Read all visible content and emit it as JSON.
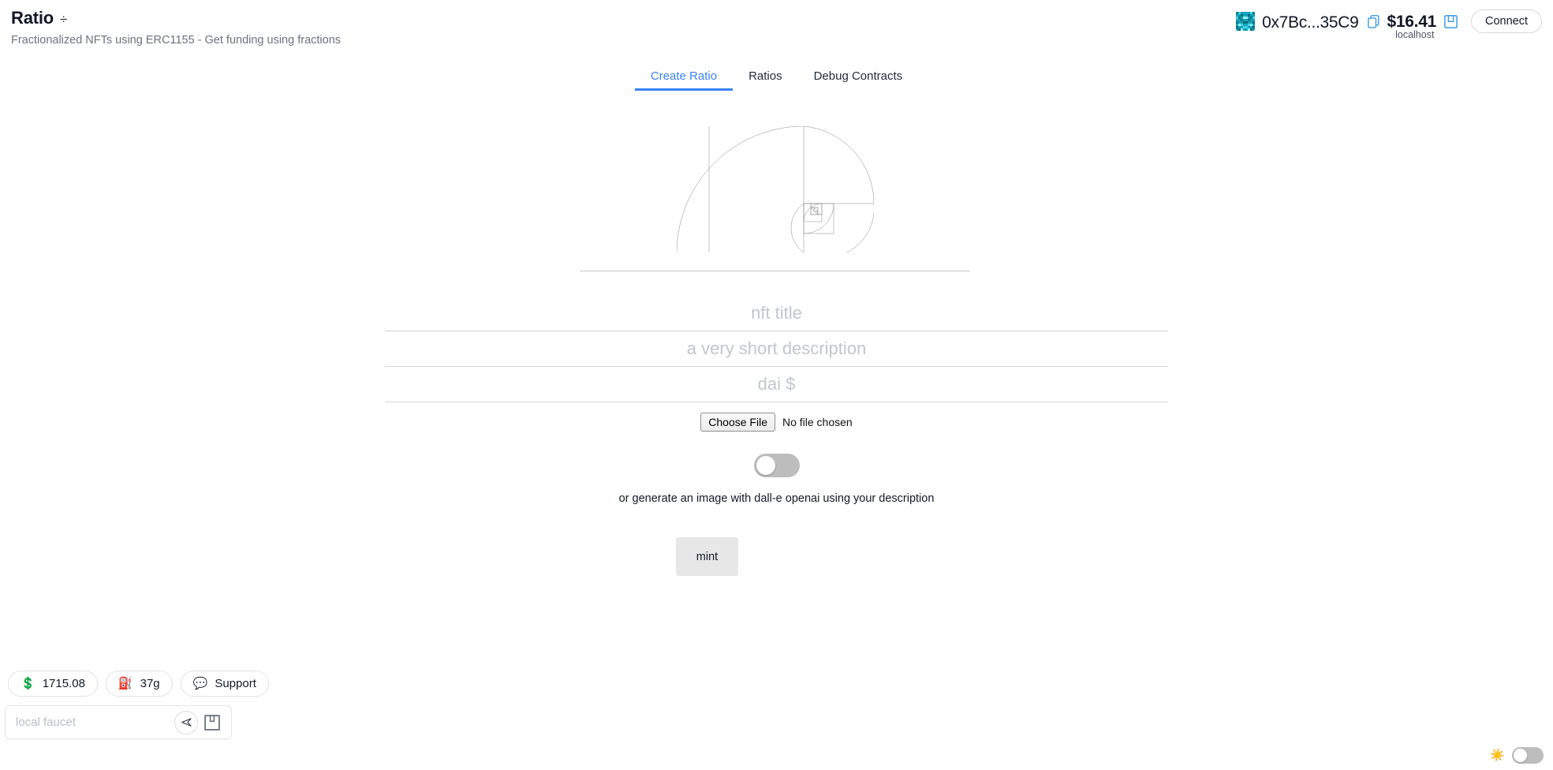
{
  "header": {
    "brand_title": "Ratio",
    "brand_icon": "divide-icon",
    "brand_icon_glyph": "÷",
    "brand_subtitle": "Fractionalized NFTs using ERC1155 - Get funding using fractions",
    "account": {
      "avatar": "blockie-avatar",
      "address": "0x7Bc...35C9",
      "copy_icon": "copy-icon",
      "balance": "$16.41",
      "network": "localhost",
      "save_icon": "save-icon",
      "connect_label": "Connect"
    }
  },
  "tabs": [
    {
      "label": "Create Ratio",
      "active": true
    },
    {
      "label": "Ratios",
      "active": false
    },
    {
      "label": "Debug Contracts",
      "active": false
    }
  ],
  "hero": {
    "graphic": "fibonacci-golden-spiral",
    "stroke_color": "#8a8a8a",
    "divider_color": "#c9c9c9"
  },
  "form": {
    "title_placeholder": "nft title",
    "title_value": "",
    "description_placeholder": "a very short description",
    "description_value": "",
    "price_placeholder": "dai $",
    "price_value": "",
    "choose_file_label": "Choose File",
    "no_file_label": "No file chosen",
    "dalle_toggle_state": "off",
    "dalle_caption": "or generate an image with dall-e openai using your description",
    "mint_label": "mint"
  },
  "bottom_left": {
    "pills": [
      {
        "icon": "dollar-icon",
        "glyph": "💲",
        "label": "1715.08"
      },
      {
        "icon": "gas-pump-icon",
        "glyph": "⛽",
        "label": "37g"
      },
      {
        "icon": "speech-bubble-icon",
        "glyph": "💬",
        "label": "Support"
      }
    ],
    "faucet_placeholder": "local faucet",
    "faucet_value": "",
    "send_icon": "send-icon",
    "bank_icon": "bank-icon"
  },
  "bottom_right": {
    "sun_icon": "sun-icon",
    "sun_glyph": "☀️",
    "theme_toggle_state": "off"
  },
  "colors": {
    "accent": "#3b82f6",
    "text": "#111827",
    "muted": "#6b7280",
    "placeholder": "#c2c6cb",
    "toggle_off": "#bdbdbd",
    "button_bg": "#e7e7e7"
  }
}
